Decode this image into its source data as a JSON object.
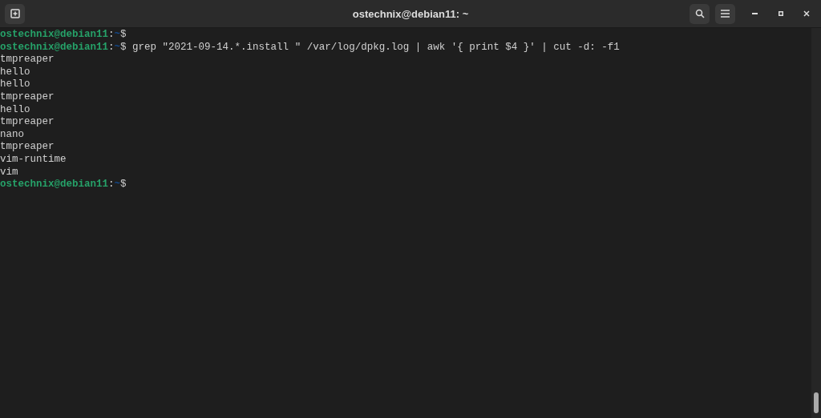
{
  "window": {
    "title": "ostechnix@debian11: ~"
  },
  "lines": [
    {
      "kind": "prompt",
      "user_host": "ostechnix@debian11",
      "separator": ":",
      "path": "~",
      "symbol": "$"
    },
    {
      "kind": "prompt",
      "user_host": "ostechnix@debian11",
      "separator": ":",
      "path": "~",
      "symbol": "$",
      "command": "grep \"2021-09-14.*.install \" /var/log/dpkg.log | awk '{ print $4 }' | cut -d: -f1"
    },
    {
      "kind": "output",
      "text": "tmpreaper"
    },
    {
      "kind": "output",
      "text": "hello"
    },
    {
      "kind": "output",
      "text": "hello"
    },
    {
      "kind": "output",
      "text": "tmpreaper"
    },
    {
      "kind": "output",
      "text": "hello"
    },
    {
      "kind": "output",
      "text": "tmpreaper"
    },
    {
      "kind": "output",
      "text": "nano"
    },
    {
      "kind": "output",
      "text": "tmpreaper"
    },
    {
      "kind": "output",
      "text": "vim-runtime"
    },
    {
      "kind": "output",
      "text": "vim"
    },
    {
      "kind": "prompt",
      "user_host": "ostechnix@debian11",
      "separator": ":",
      "path": "~",
      "symbol": "$"
    }
  ]
}
